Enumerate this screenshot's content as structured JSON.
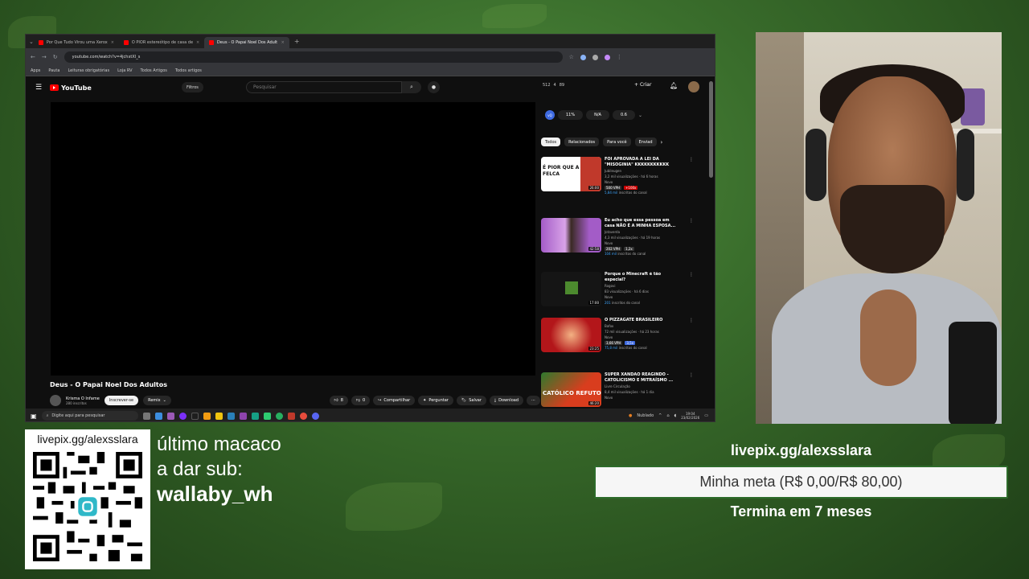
{
  "browser": {
    "tabs": [
      {
        "label": "Por Que Tudo Virou uma Xerox"
      },
      {
        "label": "O PIOR estereótipo de casa de"
      },
      {
        "label": "Deus - O Papai Noel Dos Adult"
      }
    ],
    "url": "youtube.com/watch?v=4jchxtXl_s",
    "bookmarks": [
      "Apps",
      "Pauta",
      "Leituras obrigatórias",
      "Loja RV",
      "Todos Artigos",
      "Todos artigos"
    ]
  },
  "youtube": {
    "logo": "YouTube",
    "filter_label": "Filtros",
    "search_placeholder": "Pesquisar",
    "stats": [
      "512",
      "4",
      "89"
    ],
    "create_label": "Criar",
    "video_title": "Deus - O Papai Noel Dos Adultos",
    "channel_name": "Krisma O Infame",
    "channel_subs": "280 inscritos",
    "subscribe_label": "Inscrever-se",
    "remix_label": "Remix",
    "likes": "8",
    "dislikes": "0",
    "share_label": "Compartilhar",
    "ask_label": "Perguntar",
    "save_label": "Salvar",
    "download_label": "Download",
    "ext_stats": [
      "11%",
      "N/A",
      "0.6"
    ],
    "chips": [
      "Todos",
      "Relacionados",
      "Para você",
      "Enviad"
    ],
    "recommendations": [
      {
        "title": "FOI APROVADA A LEI DA \"MISOGINIA\" KKKKKKKKKKK",
        "channel": "Jubileugen",
        "views": "3,2 mil visualizações · há 6 horas",
        "badge": "Novo",
        "vph": "500 VPH",
        "vph2": "+100x",
        "subs": "5,84 mil",
        "subs_suffix": "inscritos do canal",
        "duration": "26:00",
        "thumb_text": "É PIOR QUE A LEI FELCA",
        "color": "#ffffff"
      },
      {
        "title": "Eu acho que essa pessoa em casa NÃO É A MINHA ESPOSA...",
        "channel": "Jotaverda",
        "views": "4,3 mil visualizações · há 19 horas",
        "badge": "Novo",
        "vph": "202 VPH",
        "vph2": "1,2x",
        "subs": "104 mil",
        "subs_suffix": "inscritos do canal",
        "duration": "42:58",
        "thumb_text": "",
        "color": "#8a4fb3"
      },
      {
        "title": "Porque o Minecraft é tão especial?",
        "channel": "Rogovi",
        "views": "83 visualizações · há 6 dias",
        "badge": "Novo",
        "vph": "",
        "vph2": "",
        "subs": "201",
        "subs_suffix": "inscritos do canal",
        "duration": "17:00",
        "thumb_text": "",
        "color": "#1a1a1a"
      },
      {
        "title": "O PIZZAGATE BRASILEIRO",
        "channel": "Bafox",
        "views": "72 mil visualizações · há 23 horas",
        "badge": "Novo",
        "vph": "3,66 VPH",
        "vph2": "3,5x",
        "subs": "75,8 mil",
        "subs_suffix": "inscritos do canal",
        "duration": "23:25",
        "thumb_text": "",
        "color": "#b3161a"
      },
      {
        "title": "SUPER XANDÃO REAGINDO - CATOLICISMO E MITRAÍSMO ...",
        "channel": "Livre Circulação",
        "views": "8,4 mil visualizações · há 1 dia",
        "badge": "Novo",
        "vph": "",
        "vph2": "",
        "subs": "",
        "subs_suffix": "",
        "duration": "46:20",
        "thumb_text": "CATÓLICO REFUTO",
        "color": "#d93d1e"
      }
    ]
  },
  "taskbar": {
    "search_placeholder": "Digite aqui para pesquisar",
    "weather": "Nublado",
    "time": "19:04",
    "date": "23/02/2026"
  },
  "overlay": {
    "qr_url": "livepix.gg/alexsslara",
    "sub_line1": "último macaco",
    "sub_line2": "a dar sub:",
    "sub_name": "wallaby_wh",
    "goal_url": "livepix.gg/alexsslara",
    "goal_text": "Minha meta (R$ 0,00/R$ 80,00)",
    "goal_end": "Termina em 7 meses"
  }
}
